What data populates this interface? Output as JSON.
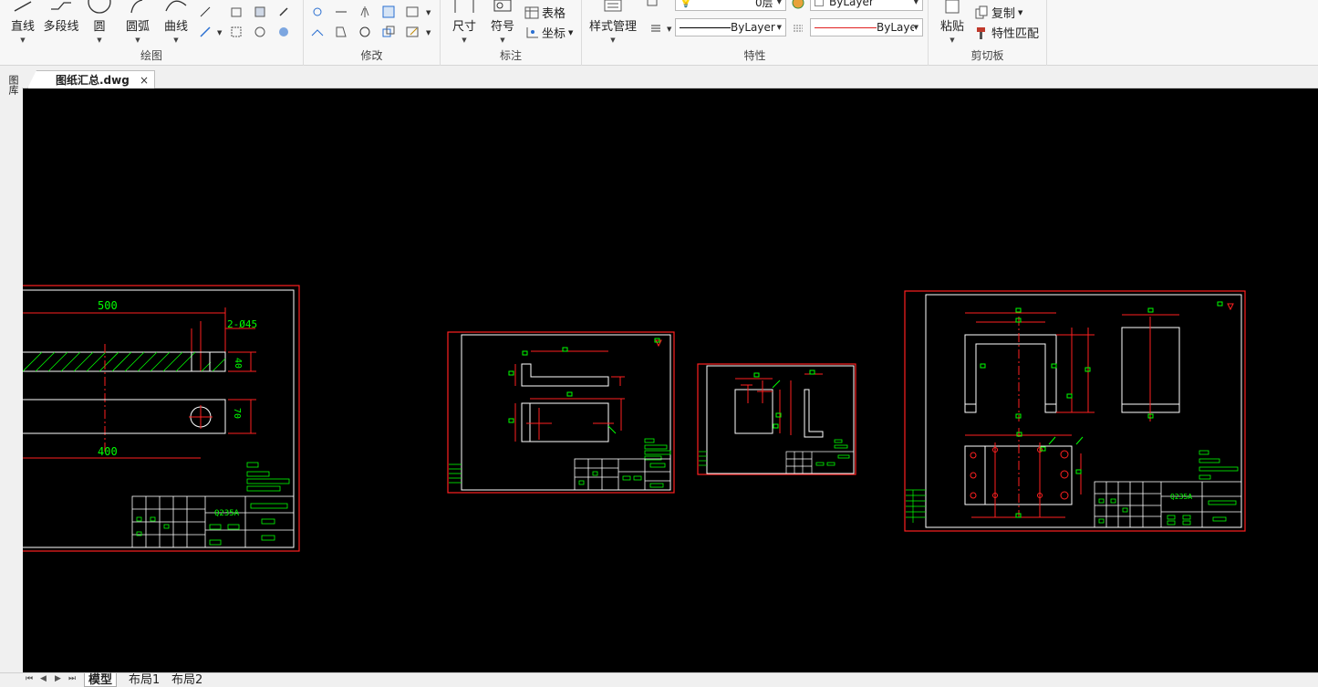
{
  "ribbon": {
    "draw": {
      "title": "绘图",
      "line": "直线",
      "polyline": "多段线",
      "circle": "圆",
      "arc": "圆弧",
      "curve": "曲线"
    },
    "modify": {
      "title": "修改"
    },
    "annotate": {
      "title": "标注",
      "dimension": "尺寸",
      "symbol": "符号",
      "table": "表格",
      "coordinate": "坐标"
    },
    "properties": {
      "title": "特性",
      "style_manager": "样式管理",
      "layer_value": "0层",
      "color_value": "ByLayer",
      "linetype_value": "ByLayer",
      "lineweight_value": "ByLaye"
    },
    "clipboard": {
      "title": "剪切板",
      "paste": "粘贴",
      "copy": "复制",
      "match_properties": "特性匹配"
    }
  },
  "document": {
    "tab_title": "图纸汇总.dwg",
    "close_glyph": "×",
    "side_label": "图库"
  },
  "drawing": {
    "dim_500": "500",
    "dim_holes": "2-Ø45",
    "dim_40": "40",
    "dim_70": "70",
    "dim_400": "400",
    "material_1": "Q235A",
    "material_2": "Q235A"
  },
  "layouts": {
    "model": "模型",
    "layout1": "布局1",
    "layout2": "布局2"
  },
  "colors": {
    "canvas": "#000000",
    "frame": "#ff2020",
    "geometry": "#ffffff",
    "annotation": "#00ff00"
  }
}
